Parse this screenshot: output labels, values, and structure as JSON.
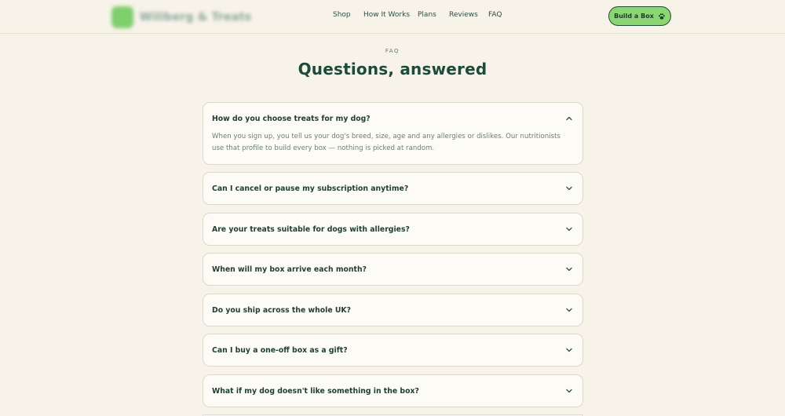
{
  "nav": {
    "logo_text": "Wiliberg & Treats",
    "links": [
      "Shop",
      "How It Works",
      "Plans",
      "Reviews",
      "FAQ"
    ],
    "cta_label": "Build a Box"
  },
  "faq": {
    "eyebrow": "FAQ",
    "title": "Questions, answered",
    "items": [
      {
        "question": "How do you choose treats for my dog?",
        "answer": "When you sign up, you tell us your dog's breed, size, age and any allergies or dislikes. Our nutritionists use that profile to build every box — nothing is picked at random.",
        "expanded": true
      },
      {
        "question": "Can I cancel or pause my subscription anytime?",
        "expanded": false
      },
      {
        "question": "Are your treats suitable for dogs with allergies?",
        "expanded": false
      },
      {
        "question": "When will my box arrive each month?",
        "expanded": false
      },
      {
        "question": "Do you ship across the whole UK?",
        "expanded": false
      },
      {
        "question": "Can I buy a one-off box as a gift?",
        "expanded": false
      },
      {
        "question": "What if my dog doesn't like something in the box?",
        "expanded": false
      }
    ]
  },
  "icons": {
    "cta": "paw-icon",
    "collapse": "chevron-up-icon",
    "expand": "chevron-down-icon"
  }
}
